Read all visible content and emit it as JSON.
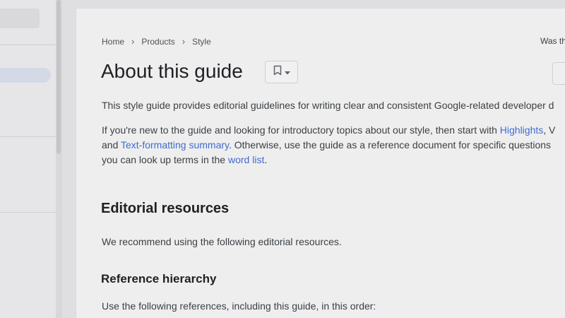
{
  "breadcrumb": [
    "Home",
    "Products",
    "Style"
  ],
  "helpful_text": "Was th",
  "title": "About this guide",
  "intro": "This style guide provides editorial guidelines for writing clear and consistent Google-related developer d",
  "para2": {
    "line1_pre": "If you're new to the guide and looking for introductory topics about our style, then start with ",
    "link_highlights": "Highlights",
    "line1_post": ", V",
    "line2_pre": "and ",
    "link_text_formatting": "Text-formatting summary",
    "line2_post": ". Otherwise, use the guide as a reference document for specific questions",
    "line3_pre": "you can look up terms in the ",
    "link_word_list": "word list",
    "line3_post": "."
  },
  "section_editorial": {
    "heading": "Editorial resources",
    "body": "We recommend using the following editorial resources."
  },
  "section_reference": {
    "heading": "Reference hierarchy",
    "body": "Use the following references, including this guide, in this order:"
  },
  "icons": {
    "bookmark": "bookmark-icon",
    "dropdown": "arrow-drop-down-icon",
    "chevron": "chevron-right-icon"
  },
  "colors": {
    "link": "#3f6ccf",
    "page_bg": "#dfdfe1",
    "card_bg": "#eeeeef"
  }
}
